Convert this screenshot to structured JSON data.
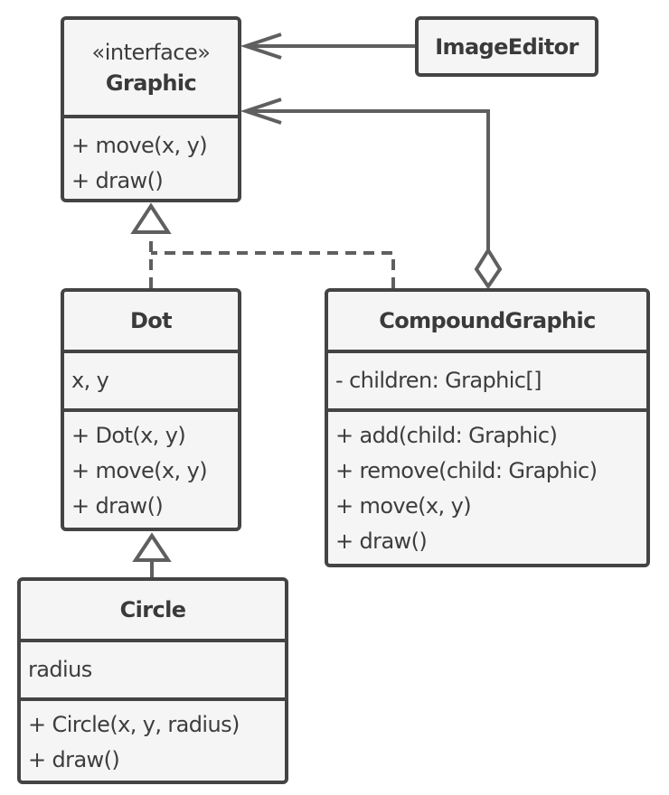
{
  "diagram": {
    "type": "uml-class-diagram",
    "line_color": "#5f5f5f",
    "box_border_color": "#444444",
    "box_fill_color": "#f5f5f5",
    "classes": {
      "graphic": {
        "stereotype": "«interface»",
        "name": "Graphic",
        "attributes": [],
        "operations": [
          "+ move(x, y)",
          "+ draw()"
        ]
      },
      "image_editor": {
        "name": "ImageEditor"
      },
      "dot": {
        "name": "Dot",
        "attributes": [
          "x, y"
        ],
        "operations": [
          "+ Dot(x, y)",
          "+ move(x, y)",
          "+ draw()"
        ]
      },
      "compound_graphic": {
        "name": "CompoundGraphic",
        "attributes": [
          "- children: Graphic[]"
        ],
        "operations": [
          "+ add(child: Graphic)",
          "+ remove(child: Graphic)",
          "+ move(x, y)",
          "+ draw()"
        ]
      },
      "circle": {
        "name": "Circle",
        "attributes": [
          "radius"
        ],
        "operations": [
          "+ Circle(x, y, radius)",
          "+ draw()"
        ]
      }
    },
    "relationships": [
      {
        "from": "ImageEditor",
        "to": "Graphic",
        "kind": "association",
        "arrow": "open-arrow"
      },
      {
        "from": "CompoundGraphic",
        "to": "Graphic",
        "kind": "aggregation",
        "arrow": "open-arrow",
        "source_end": "hollow-diamond"
      },
      {
        "from": "Dot",
        "to": "Graphic",
        "kind": "realization",
        "arrow": "hollow-triangle",
        "line": "dashed"
      },
      {
        "from": "CompoundGraphic",
        "to": "Graphic",
        "kind": "realization",
        "arrow": "hollow-triangle",
        "line": "dashed"
      },
      {
        "from": "Circle",
        "to": "Dot",
        "kind": "inheritance",
        "arrow": "hollow-triangle",
        "line": "solid"
      }
    ]
  }
}
